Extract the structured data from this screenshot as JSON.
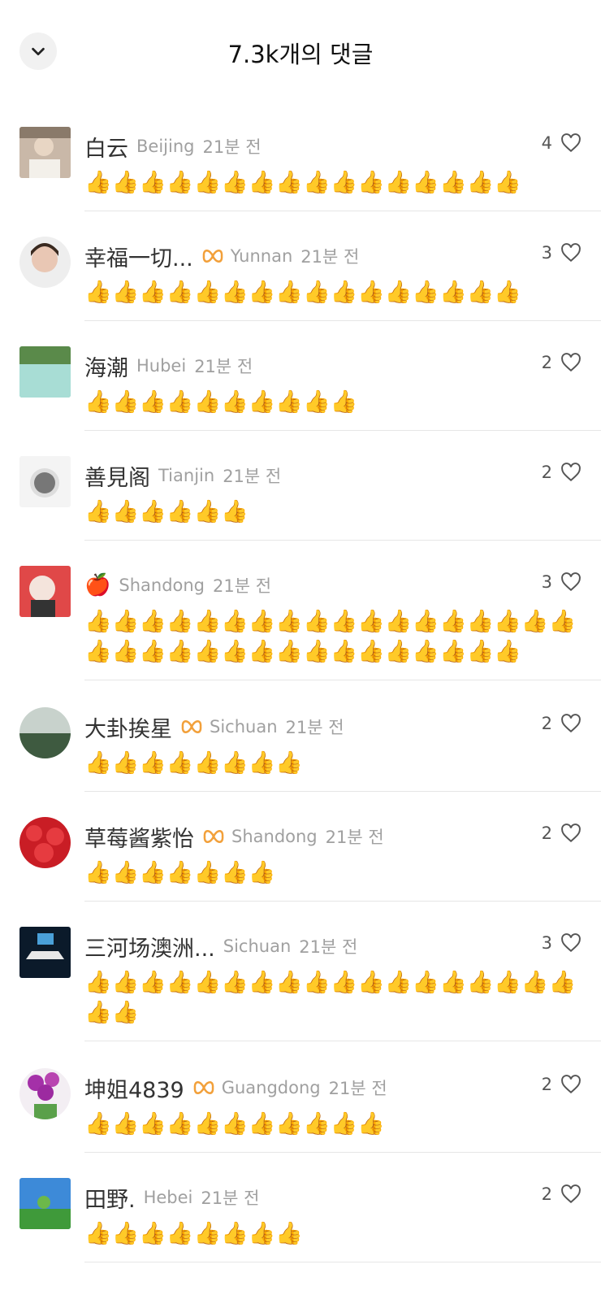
{
  "header": {
    "title": "7.3k개의 댓글",
    "collapse_icon": "chevron-down-icon"
  },
  "comments": [
    {
      "name": "白云",
      "badge": false,
      "location": "Beijing",
      "time": "21분 전",
      "likes": "4",
      "text": "👍👍👍👍👍👍👍👍👍👍👍👍👍👍👍👍"
    },
    {
      "name": "幸福一切...",
      "badge": true,
      "location": "Yunnan",
      "time": "21분 전",
      "likes": "3",
      "text": "👍👍👍👍👍👍👍👍👍👍👍👍👍👍👍👍"
    },
    {
      "name": "海潮",
      "badge": false,
      "location": "Hubei",
      "time": "21분 전",
      "likes": "2",
      "text": "👍👍👍👍👍👍👍👍👍👍"
    },
    {
      "name": "善見阁",
      "badge": false,
      "location": "Tianjin",
      "time": "21분 전",
      "likes": "2",
      "text": "👍👍👍👍👍👍"
    },
    {
      "name": "🍎",
      "badge": false,
      "location": "Shandong",
      "time": "21분 전",
      "likes": "3",
      "text": "👍👍👍👍👍👍👍👍👍👍👍👍👍👍👍👍👍👍👍👍👍👍👍👍👍👍👍👍👍👍👍👍👍👍"
    },
    {
      "name": "大卦挨星",
      "badge": true,
      "location": "Sichuan",
      "time": "21분 전",
      "likes": "2",
      "text": "👍👍👍👍👍👍👍👍"
    },
    {
      "name": "草莓酱紫怡",
      "badge": true,
      "location": "Shandong",
      "time": "21분 전",
      "likes": "2",
      "text": "👍👍👍👍👍👍👍"
    },
    {
      "name": "三河场澳洲...",
      "badge": false,
      "location": "Sichuan",
      "time": "21분 전",
      "likes": "3",
      "text": "👍👍👍👍👍👍👍👍👍👍👍👍👍👍👍👍👍👍👍👍"
    },
    {
      "name": "坤姐4839",
      "badge": true,
      "location": "Guangdong",
      "time": "21분 전",
      "likes": "2",
      "text": "👍👍👍👍👍👍👍👍👍👍👍"
    },
    {
      "name": "田野.",
      "badge": false,
      "location": "Hebei",
      "time": "21분 전",
      "likes": "2",
      "text": "👍👍👍👍👍👍👍👍"
    }
  ],
  "colors": {
    "badge": "#f2a03a",
    "meta": "#a0a0a0",
    "divider": "#e6e6e6"
  }
}
